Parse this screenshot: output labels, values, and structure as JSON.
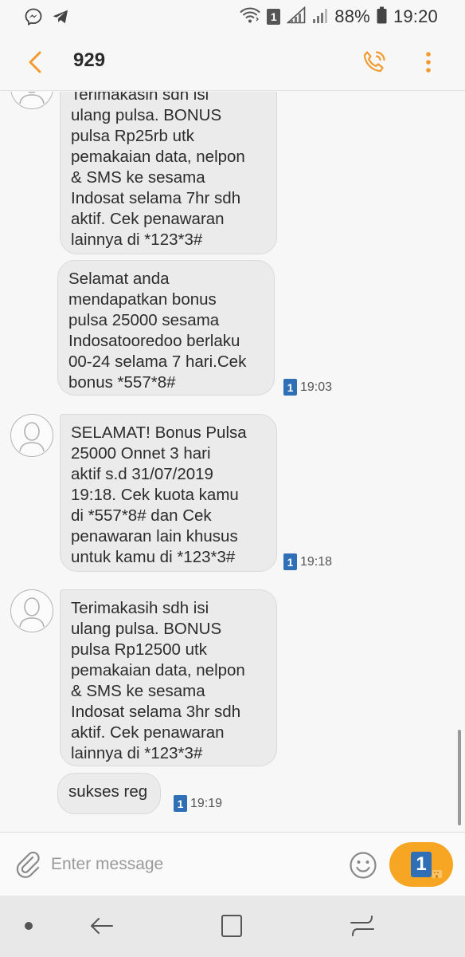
{
  "status_bar": {
    "sim_indicator": "1",
    "battery": "88%",
    "time": "19:20"
  },
  "app_bar": {
    "title": "929"
  },
  "messages": [
    {
      "text": "Terimakasih sdh isi\nulang pulsa. BONUS\npulsa Rp25rb utk\npemakaian data, nelpon\n& SMS ke sesama\nIndosat selama 7hr sdh\naktif. Cek penawaran\nlainnya di *123*3#",
      "sim": "",
      "time": ""
    },
    {
      "text": "Selamat anda\nmendapatkan bonus\npulsa 25000 sesama\nIndosatooredoo berlaku\n00-24 selama 7 hari.Cek\nbonus *557*8#",
      "sim": "1",
      "time": "19:03"
    },
    {
      "text": "SELAMAT! Bonus Pulsa\n25000 Onnet 3 hari\naktif s.d 31/07/2019\n19:18.  Cek kuota kamu\ndi *557*8# dan Cek\npenawaran lain khusus\nuntuk kamu di *123*3#",
      "sim": "1",
      "time": "19:18"
    },
    {
      "text": "Terimakasih sdh isi\nulang pulsa. BONUS\npulsa Rp12500 utk\npemakaian data, nelpon\n& SMS ke sesama\nIndosat selama 3hr sdh\naktif. Cek penawaran\nlainnya di *123*3#",
      "sim": "",
      "time": ""
    },
    {
      "text": "sukses reg",
      "sim": "1",
      "time": "19:19"
    }
  ],
  "composer": {
    "placeholder": "Enter message",
    "send_sim": "1"
  },
  "colors": {
    "accent": "#f6a623",
    "sim_badge": "#2f6fb5",
    "bubble": "#ebebeb"
  },
  "icons": {
    "status_left": [
      "messenger-icon",
      "telegram-icon"
    ],
    "status_right": [
      "wifi-icon",
      "sim-1-icon",
      "signal-sim1-icon",
      "signal-sim2-icon",
      "battery-icon"
    ],
    "app_bar": [
      "back-arrow-icon",
      "phone-call-icon",
      "more-vert-icon"
    ],
    "composer": [
      "paperclip-icon",
      "emoji-icon",
      "send-icon"
    ],
    "nav": [
      "nav-dot-icon",
      "nav-back-icon",
      "nav-recents-icon",
      "nav-home-icon"
    ]
  }
}
